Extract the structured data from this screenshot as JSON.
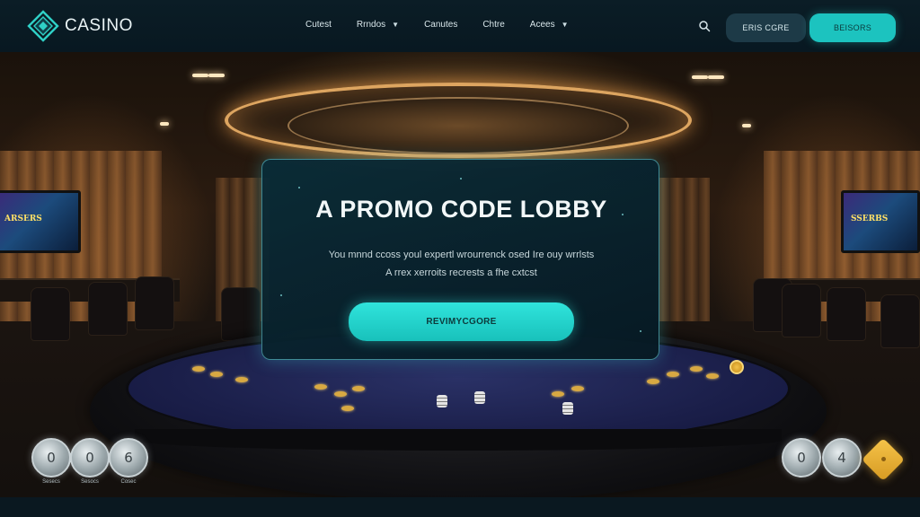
{
  "header": {
    "logo_text": "CASINO",
    "nav": [
      {
        "label": "Cutest",
        "has_dropdown": false
      },
      {
        "label": "Rrndos",
        "has_dropdown": true
      },
      {
        "label": "Canutes",
        "has_dropdown": false
      },
      {
        "label": "Chtre",
        "has_dropdown": false
      },
      {
        "label": "Acees",
        "has_dropdown": true
      }
    ],
    "search_icon": "search-icon",
    "login_label": "ERIS CGRE",
    "register_label": "BEISORS"
  },
  "scene": {
    "tv_left_text": "ARSERS",
    "tv_right_text": "SSERBS"
  },
  "promo": {
    "title": "A PROMO CODE LOBBY",
    "line1": "You mnnd ccoss youl expertl wrourrenck osed Ire ouy wrrlsts",
    "line2": "A rrex xerroits recrests a fhe cxtcst",
    "button_label": "REVIMYCGORE"
  },
  "chips_left": [
    {
      "value": "0",
      "caption": "Sesecs"
    },
    {
      "value": "0",
      "caption": "Sesocs"
    },
    {
      "value": "6",
      "caption": "Cosec"
    }
  ],
  "chips_right": [
    {
      "value": "0"
    },
    {
      "value": "4"
    }
  ],
  "colors": {
    "accent": "#1cc3bf",
    "header_bg": "#0b1d26",
    "login_bg": "#1d3a47",
    "card_border": "#6edce6"
  }
}
